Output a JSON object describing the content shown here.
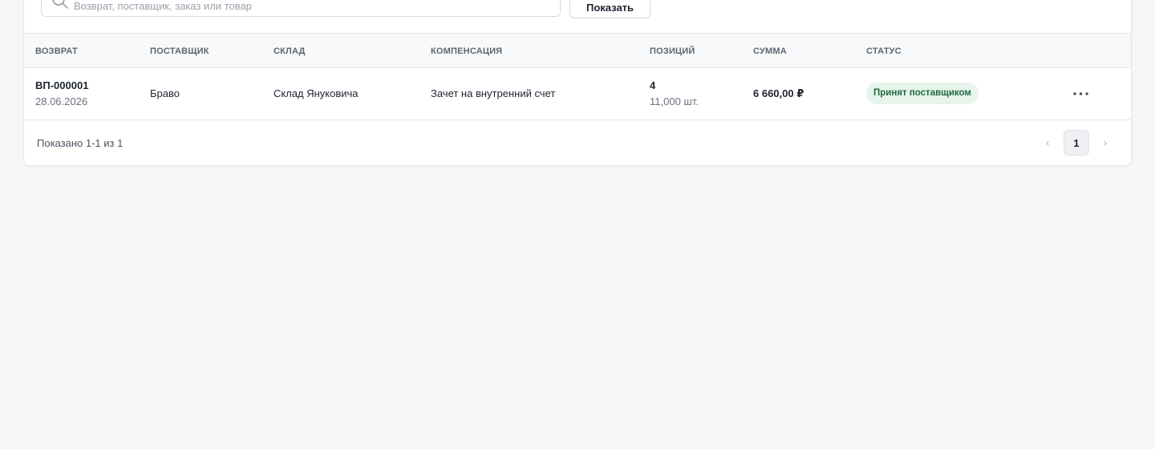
{
  "filters": {
    "search_placeholder": "Возврат, поставщик, заказ или товар",
    "search_value": "",
    "show_button_label": "Показать"
  },
  "table": {
    "columns": [
      "Возврат",
      "Поставщик",
      "Склад",
      "Компенсация",
      "Позиций",
      "Сумма",
      "Статус"
    ],
    "rows": [
      {
        "number": "ВП-000001",
        "date": "28.06.2026",
        "supplier": "Браво",
        "warehouse": "Склад Януковича",
        "compensation": "Зачет на внутренний счет",
        "positions_count": "4",
        "quantity": "11,000 шт.",
        "amount": "6 660,00 ₽",
        "status": "Принят поставщиком"
      }
    ]
  },
  "pagination": {
    "summary": "Показано 1-1 из 1",
    "current_page": "1",
    "prev_label": "‹",
    "next_label": "›"
  },
  "colors": {
    "status_accepted_bg": "#e6f4ec",
    "status_accepted_text": "#1f6b3f"
  },
  "icons": {
    "search": "search-icon",
    "row_actions": "more-horizontal-icon"
  }
}
